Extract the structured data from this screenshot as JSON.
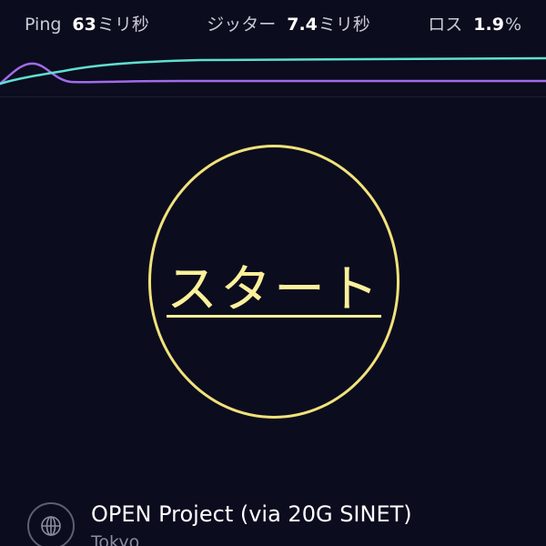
{
  "stats": [
    {
      "label": "Ping",
      "value": "63",
      "unit": "ミリ秒"
    },
    {
      "label": "ジッター",
      "value": "7.4",
      "unit": "ミリ秒"
    },
    {
      "label": "ロス",
      "value": "1.9",
      "unit": "%"
    }
  ],
  "colors": {
    "background": "#0b0c1e",
    "accent": "#f1e27a",
    "upload_line": "#5fe0d0",
    "download_line": "#a06be8"
  },
  "start": {
    "label": "スタート"
  },
  "server": {
    "icon": "globe-icon",
    "name": "OPEN Project (via 20G SINET)",
    "location": "Tokyo"
  }
}
